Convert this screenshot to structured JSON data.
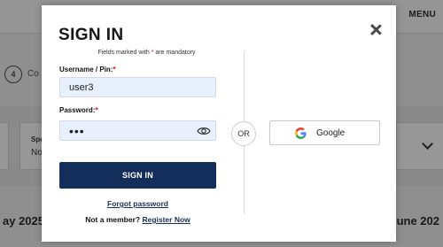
{
  "background": {
    "menu_label": "MENU",
    "step_number": "4",
    "step_label": "Co",
    "card_label_1": "Spe",
    "card_label_2": "No",
    "month_left": "ay 2025",
    "month_right": "June 202"
  },
  "modal": {
    "title": "SIGN IN",
    "mandatory_note_prefix": "Fields marked with ",
    "mandatory_note_asterisk": "*",
    "mandatory_note_suffix": " are mandatory",
    "username_label": "Username / Pin:",
    "password_label": "Password:",
    "required_marker": "*",
    "username_value": "user3",
    "password_value": "•••",
    "signin_label": "SIGN IN",
    "forgot_label": "Forgot password",
    "not_member_label": "Not a member?",
    "register_label": "Register Now",
    "or_label": "OR",
    "google_label": "Google"
  },
  "icons": {
    "close": "close-icon",
    "eye": "eye-icon",
    "google": "google-icon",
    "chevron": "chevron-down-icon"
  },
  "colors": {
    "primary_button": "#142e5b",
    "link": "#1c2f5a",
    "required": "#d0021b",
    "autofill_background": "#e8f0fe"
  }
}
